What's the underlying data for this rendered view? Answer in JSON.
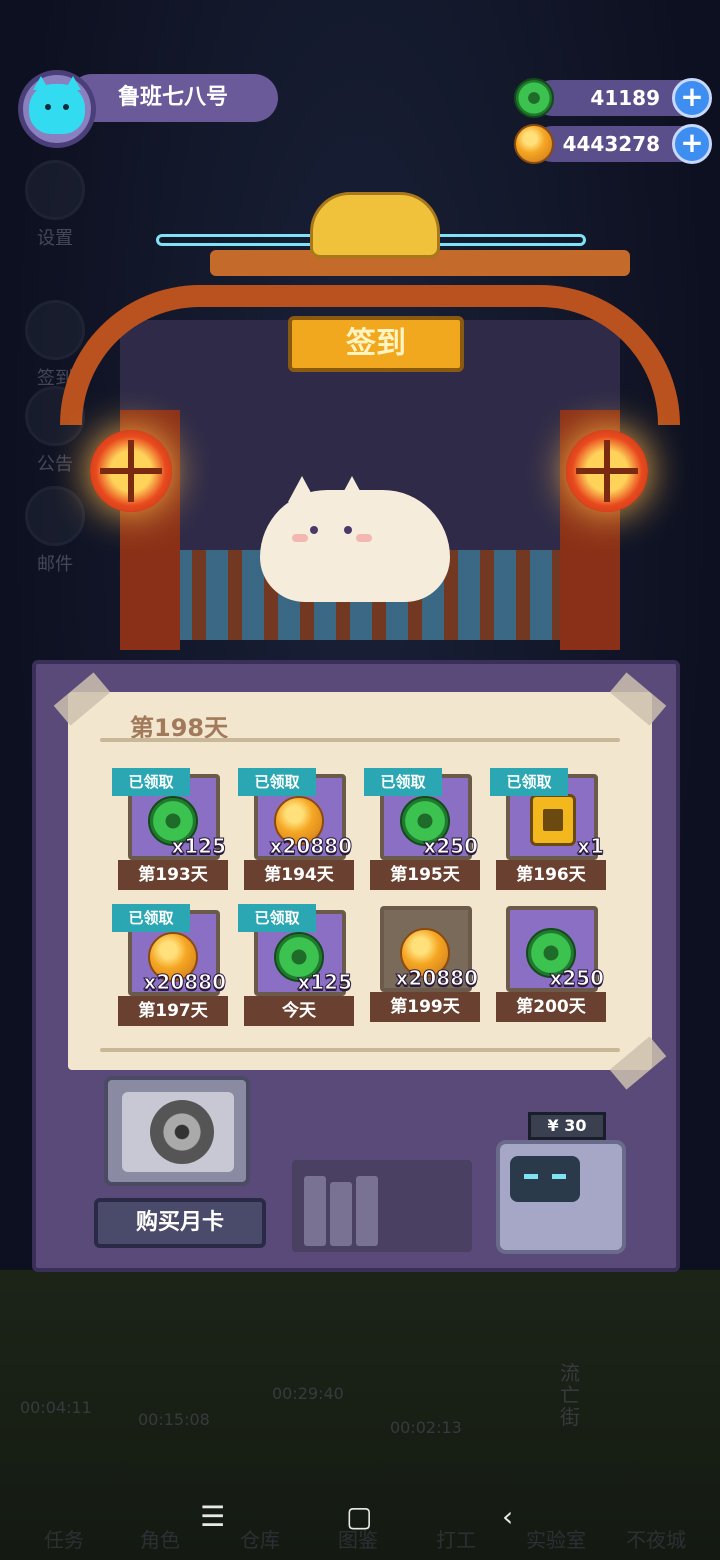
{
  "player": {
    "name": "鲁班七八号"
  },
  "currencies": [
    {
      "icon": "jade-coin-icon",
      "value": "41189"
    },
    {
      "icon": "gold-coin-icon",
      "value": "4443278"
    }
  ],
  "side_menu": [
    "设置",
    "签到",
    "公告",
    "邮件"
  ],
  "gate": {
    "sign": "签到"
  },
  "checkin": {
    "current_day": "第198天",
    "claimed_tag": "已领取",
    "rewards": [
      {
        "day": "第193天",
        "item": "jade",
        "qty": "x125",
        "claimed": true
      },
      {
        "day": "第194天",
        "item": "gold",
        "qty": "x20880",
        "claimed": true
      },
      {
        "day": "第195天",
        "item": "jade",
        "qty": "x250",
        "claimed": true
      },
      {
        "day": "第196天",
        "item": "battery",
        "qty": "x1",
        "claimed": true
      },
      {
        "day": "第197天",
        "item": "gold",
        "qty": "x20880",
        "claimed": true
      },
      {
        "day": "今天",
        "item": "jade",
        "qty": "x125",
        "claimed": true
      },
      {
        "day": "第199天",
        "item": "gold",
        "qty": "x20880",
        "claimed": false
      },
      {
        "day": "第200天",
        "item": "jade",
        "qty": "x250",
        "claimed": false
      }
    ]
  },
  "monthly": {
    "button": "购买月卡",
    "price": "¥ 30"
  },
  "background": {
    "timers": [
      "00:04:11",
      "00:15:08",
      "00:29:40",
      "00:02:13"
    ],
    "street_sign": "流亡街",
    "tabs": [
      "任务",
      "角色",
      "仓库",
      "图鉴",
      "打工",
      "实验室",
      "不夜城"
    ]
  },
  "system_nav": {
    "menu": "☰",
    "home": "▢",
    "back": "‹"
  },
  "colors": {
    "claimed_tag": "#2aa7b3",
    "card_purple": "#8a6fc4",
    "plus_button": "#3d8ef0"
  }
}
